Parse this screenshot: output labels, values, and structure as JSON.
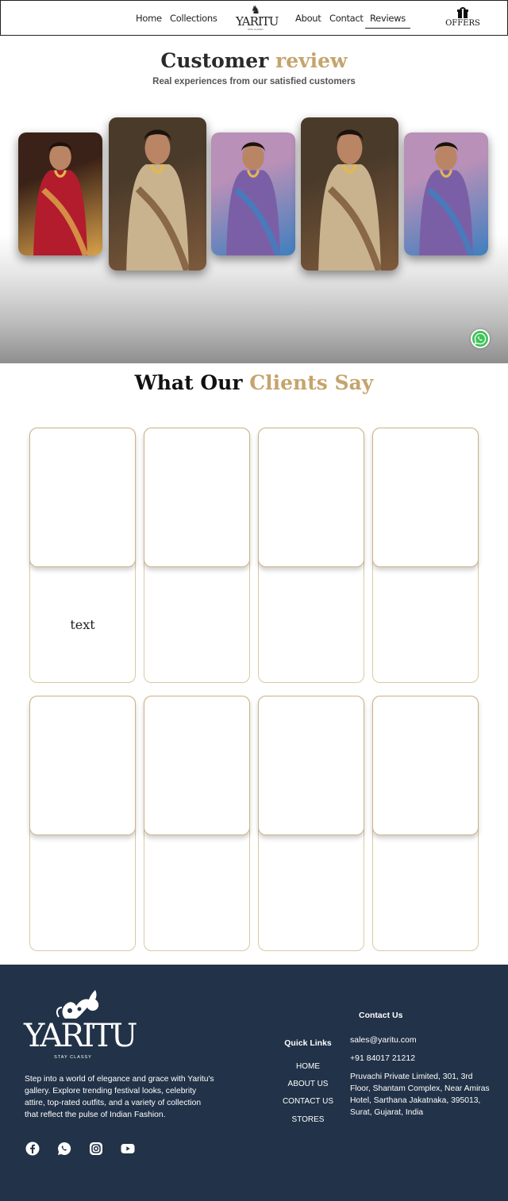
{
  "nav": {
    "items": [
      "Home",
      "Collections",
      "About",
      "Contact",
      "Reviews"
    ],
    "active": "Reviews",
    "logo_text": "YARITU",
    "logo_tag": "STAY CLASSY",
    "offers_label": "OFFERS",
    "offers_icon": "gift-icon"
  },
  "review": {
    "title_main": "Customer",
    "title_accent": "review",
    "subtitle": "Real experiences from our satisfied customers",
    "accent_color": "#c5a46d",
    "cards": [
      {
        "name": "review-photo-red-saree",
        "palette": [
          "#3b2218",
          "#b31c2c",
          "#d9a24a"
        ]
      },
      {
        "name": "review-photo-bridal-lehenga",
        "palette": [
          "#4a3a2a",
          "#c9b38e",
          "#7d5a3a"
        ]
      },
      {
        "name": "review-photo-lavender-saree",
        "palette": [
          "#b890b8",
          "#7b5fa6",
          "#3f7fbf"
        ]
      },
      {
        "name": "review-photo-bridal-lehenga-2",
        "palette": [
          "#4a3a2a",
          "#c9b38e",
          "#7d5a3a"
        ]
      },
      {
        "name": "review-photo-lavender-saree-2",
        "palette": [
          "#b890b8",
          "#7b5fa6",
          "#3f7fbf"
        ]
      }
    ]
  },
  "whatsapp_icon": "whatsapp-icon",
  "clients": {
    "title_main": "What Our",
    "title_accent": "Clients Say",
    "cards": [
      {
        "text": "text"
      },
      {
        "text": ""
      },
      {
        "text": ""
      },
      {
        "text": ""
      },
      {
        "text": ""
      },
      {
        "text": ""
      },
      {
        "text": ""
      },
      {
        "text": ""
      }
    ]
  },
  "footer": {
    "logo_text": "YARITU",
    "logo_tag": "STAY CLASSY",
    "description": "Step into a world of elegance and grace with Yaritu's gallery. Explore trending festival looks, celebrity attire, top-rated outfits, and a variety of collection that reflect the pulse of Indian Fashion.",
    "social_icons": [
      "facebook-icon",
      "whatsapp-icon",
      "instagram-icon",
      "youtube-icon"
    ],
    "quick_links_title": "Quick Links",
    "quick_links": [
      "HOME",
      "ABOUT US",
      "CONTACT US",
      "STORES"
    ],
    "contact_title": "Contact Us",
    "email": "sales@yaritu.com",
    "phone": "+91 84017 21212",
    "address": "Pruvachi Private Limited, 301, 3rd Floor, Shantam Complex, Near Amiras Hotel, Sarthana Jakatnaka, 395013, Surat, Gujarat, India",
    "bg_color": "#223248"
  }
}
